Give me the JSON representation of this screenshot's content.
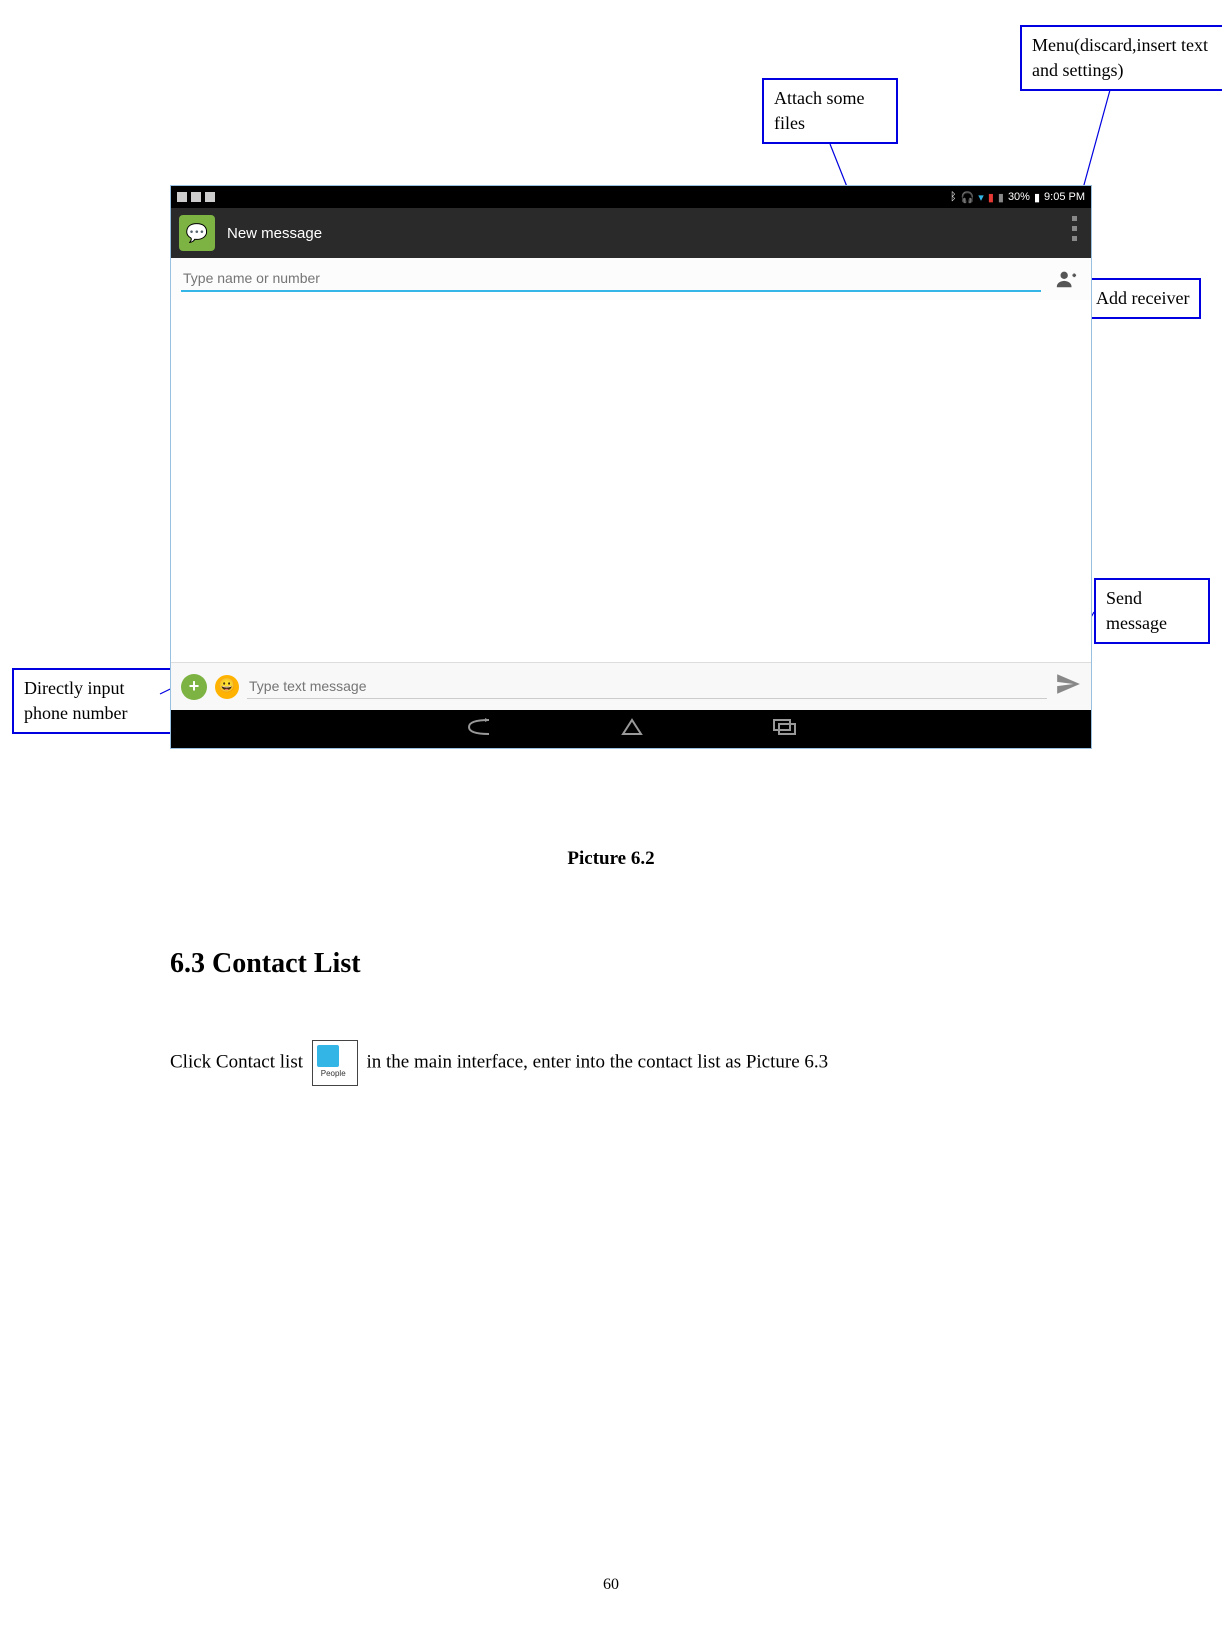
{
  "callouts": {
    "attach": "Attach some files",
    "menu": "Menu(discard,insert text and settings)",
    "add_receiver": "Add receiver",
    "send": "Send message",
    "direct_input": "Directly input phone number"
  },
  "statusbar": {
    "battery": "30%",
    "time": "9:05 PM"
  },
  "actionbar": {
    "title": "New message"
  },
  "recipient": {
    "placeholder": "Type name or number"
  },
  "compose": {
    "placeholder": "Type text message"
  },
  "caption": "Picture 6.2",
  "section": {
    "heading": "6.3 Contact List",
    "body_before": "Click Contact list",
    "body_after": "in the main interface, enter into the contact list as Picture 6.3"
  },
  "page_number": "60"
}
